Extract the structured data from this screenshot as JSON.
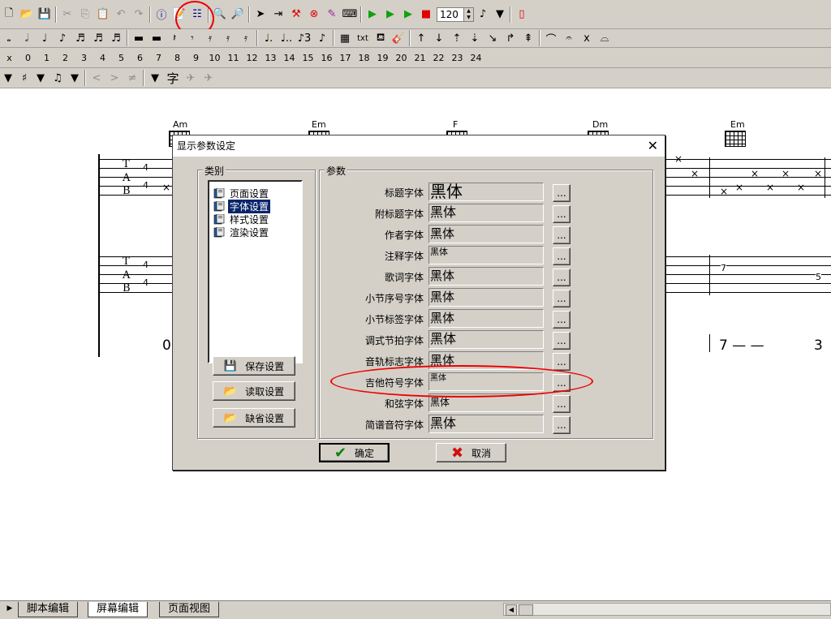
{
  "toolbar": {
    "tempo_value": "120",
    "fret_numbers": [
      "x",
      "0",
      "1",
      "2",
      "3",
      "4",
      "5",
      "6",
      "7",
      "8",
      "9",
      "10",
      "11",
      "12",
      "13",
      "14",
      "15",
      "16",
      "17",
      "18",
      "19",
      "20",
      "21",
      "22",
      "23",
      "24"
    ],
    "text_tool_label": "txt",
    "lyric_tool_label": "字"
  },
  "score": {
    "chords": [
      "Am",
      "Em",
      "F",
      "Dm",
      "Em"
    ],
    "time_sig_top": "4",
    "time_sig_bottom": "4",
    "tab_letters": [
      "T",
      "A",
      "B"
    ],
    "jianpu_left": "0",
    "jianpu_right_a": "7 — —",
    "jianpu_right_b": "3",
    "tab_note_a": "7",
    "tab_note_b": "5"
  },
  "dialog": {
    "title": "显示参数设定",
    "category_label": "类别",
    "params_label": "参数",
    "tree_items": [
      "页面设置",
      "字体设置",
      "样式设置",
      "渲染设置"
    ],
    "selected_item": 1,
    "buttons": {
      "save": "保存设置",
      "load": "读取设置",
      "default": "缺省设置",
      "ok": "确定",
      "cancel": "取消"
    },
    "browse_label": "...",
    "params": [
      {
        "label": "标题字体",
        "value": "黑体"
      },
      {
        "label": "附标题字体",
        "value": "黑体"
      },
      {
        "label": "作者字体",
        "value": "黑体"
      },
      {
        "label": "注释字体",
        "value": "黑体"
      },
      {
        "label": "歌词字体",
        "value": "黑体"
      },
      {
        "label": "小节序号字体",
        "value": "黑体"
      },
      {
        "label": "小节标签字体",
        "value": "黑体"
      },
      {
        "label": "调式节拍字体",
        "value": "黑体"
      },
      {
        "label": "音轨标志字体",
        "value": "黑体"
      },
      {
        "label": "吉他符号字体",
        "value": "黑体"
      },
      {
        "label": "和弦字体",
        "value": "黑体"
      },
      {
        "label": "简谱音符字体",
        "value": "黑体"
      }
    ]
  },
  "tabs": [
    "脚本编辑",
    "屏幕编辑",
    "页面视图"
  ],
  "active_tab": 1,
  "colors": {
    "selection": "#0a246a",
    "annotation": "#e00000",
    "ok_check": "#108010",
    "cancel_x": "#d01010"
  }
}
